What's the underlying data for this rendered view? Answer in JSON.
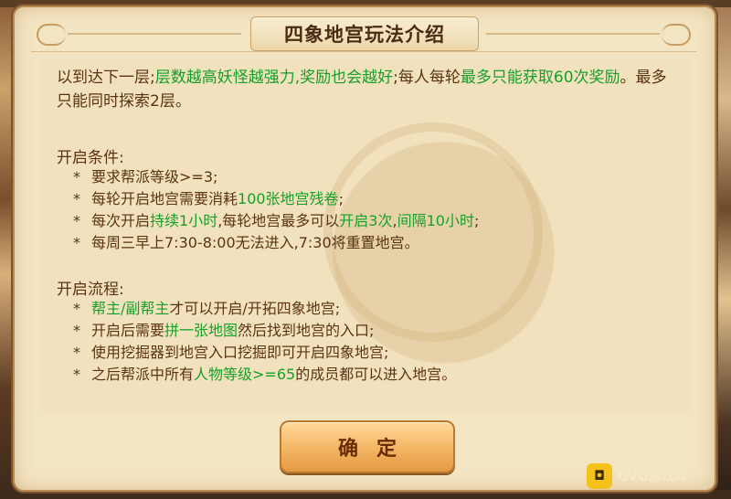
{
  "dialog": {
    "title": "四象地宫玩法介绍",
    "intro": {
      "s1": "以到达下一层;",
      "s2": "层数越高妖怪越强力,奖励也会越好",
      "s3": ";每人每轮",
      "s4": "最多只能获取60次奖励",
      "s5": "。最多只能同时探索2层。"
    },
    "conditions": {
      "heading": "开启条件:",
      "items": [
        {
          "a": "要求帮派等级>=3;",
          "b": "",
          "c": "",
          "d": "",
          "e": "",
          "f": ""
        },
        {
          "a": "每轮开启地宫需要消耗",
          "b": "100张地宫残卷",
          "c": ";",
          "d": "",
          "e": "",
          "f": ""
        },
        {
          "a": "每次开启",
          "b": "持续1小时",
          "c": ",每轮地宫最多可以",
          "d": "开启3次",
          "e": ",",
          "f": "间隔10小时"
        },
        {
          "a": "每周三早上7:30-8:00无法进入,7:30将重置地宫。",
          "b": "",
          "c": "",
          "d": "",
          "e": "",
          "f": ""
        }
      ],
      "tail": ";"
    },
    "flow": {
      "heading": "开启流程:",
      "items": [
        {
          "a": "",
          "b": "帮主/副帮主",
          "c": "才可以开启/开拓四象地宫;"
        },
        {
          "a": "开启后需要",
          "b": "拼一张地图",
          "c": "然后找到地宫的入口;"
        },
        {
          "a": "使用挖掘器到地宫入口挖掘即可开启四象地宫;",
          "b": "",
          "c": ""
        },
        {
          "a": "之后帮派中所有",
          "b": "人物等级>=65",
          "c": "的成员都可以进入地宫。"
        }
      ]
    },
    "bullet_symbol": "*",
    "confirm_label": "确定"
  },
  "brand": {
    "icon_text": "◘",
    "name": "OVG游戏网"
  },
  "colors": {
    "highlight": "#16a02a",
    "text": "#5a3413",
    "button": "#f2b463"
  }
}
